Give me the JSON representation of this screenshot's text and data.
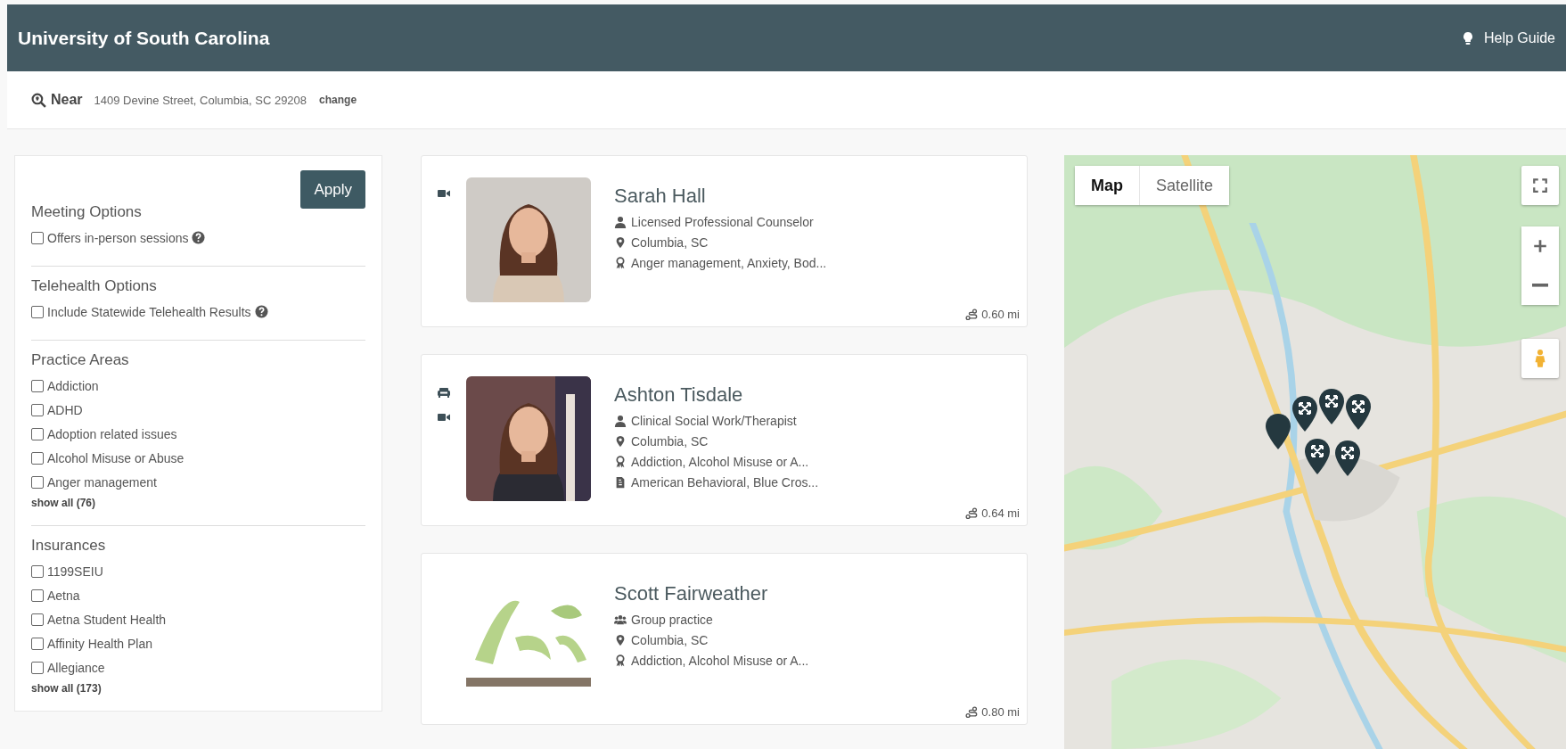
{
  "header": {
    "title": "University of South Carolina",
    "help": "Help Guide"
  },
  "location": {
    "label": "Near",
    "address": "1409 Devine Street, Columbia, SC 29208",
    "change": "change"
  },
  "filters": {
    "apply": "Apply",
    "sections": [
      {
        "title": "Meeting Options",
        "options": [
          {
            "label": "Offers in-person sessions",
            "checked": false,
            "help": true
          }
        ]
      },
      {
        "title": "Telehealth Options",
        "options": [
          {
            "label": "Include Statewide Telehealth Results",
            "checked": false,
            "help": true
          }
        ]
      },
      {
        "title": "Practice Areas",
        "options": [
          {
            "label": "Addiction",
            "checked": false,
            "help": false
          },
          {
            "label": "ADHD",
            "checked": false,
            "help": false
          },
          {
            "label": "Adoption related issues",
            "checked": false,
            "help": false
          },
          {
            "label": "Alcohol Misuse or Abuse",
            "checked": false,
            "help": false
          },
          {
            "label": "Anger management",
            "checked": false,
            "help": false
          }
        ],
        "show_all": "show all (76)"
      },
      {
        "title": "Insurances",
        "options": [
          {
            "label": "1199SEIU",
            "checked": false,
            "help": false
          },
          {
            "label": "Aetna",
            "checked": false,
            "help": false
          },
          {
            "label": "Aetna Student Health",
            "checked": false,
            "help": false
          },
          {
            "label": "Affinity Health Plan",
            "checked": false,
            "help": false
          },
          {
            "label": "Allegiance",
            "checked": false,
            "help": false
          }
        ],
        "show_all": "show all (173)"
      }
    ]
  },
  "results": [
    {
      "name": "Sarah Hall",
      "meeting": {
        "in_person": false,
        "video": true
      },
      "details": [
        {
          "kind": "person",
          "text": "Licensed Professional Counselor"
        },
        {
          "kind": "location",
          "text": "Columbia, SC"
        },
        {
          "kind": "specialties",
          "text": "Anger management, Anxiety, Bod..."
        }
      ],
      "distance": "0.60 mi",
      "photo": {
        "kind": "portrait"
      }
    },
    {
      "name": "Ashton Tisdale",
      "meeting": {
        "in_person": true,
        "video": true
      },
      "details": [
        {
          "kind": "person",
          "text": "Clinical Social Work/Therapist"
        },
        {
          "kind": "location",
          "text": "Columbia, SC"
        },
        {
          "kind": "specialties",
          "text": "Addiction, Alcohol Misuse or A..."
        },
        {
          "kind": "insurance",
          "text": "American Behavioral, Blue Cros..."
        }
      ],
      "distance": "0.64 mi",
      "photo": {
        "kind": "portrait"
      }
    },
    {
      "name": "Scott Fairweather",
      "meeting": {
        "in_person": false,
        "video": false
      },
      "details": [
        {
          "kind": "group",
          "text": "Group practice"
        },
        {
          "kind": "location",
          "text": "Columbia, SC"
        },
        {
          "kind": "specialties",
          "text": "Addiction, Alcohol Misuse or A..."
        }
      ],
      "distance": "0.80 mi",
      "photo": {
        "kind": "logo"
      }
    }
  ],
  "map": {
    "map_types": [
      {
        "label": "Map",
        "selected": true
      },
      {
        "label": "Satellite",
        "selected": false
      }
    ]
  }
}
